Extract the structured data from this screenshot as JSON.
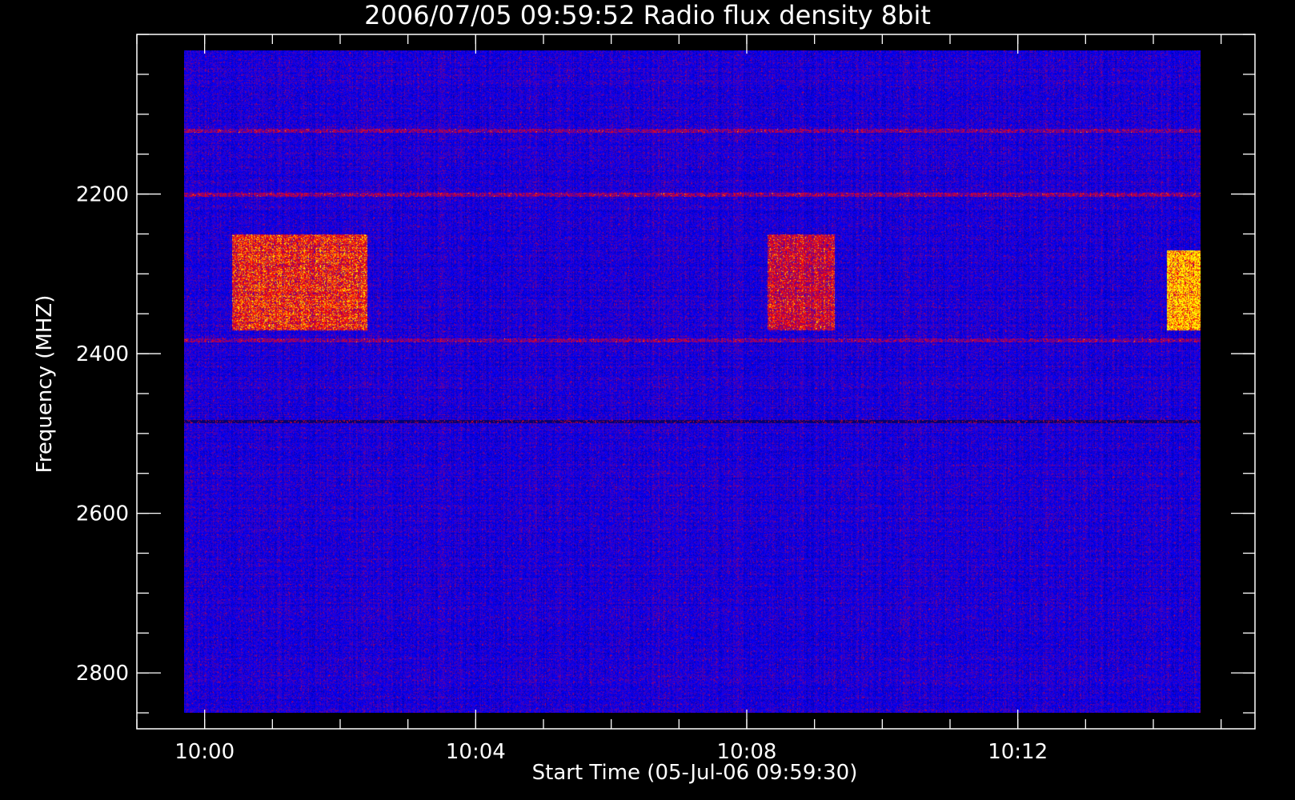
{
  "chart_data": {
    "type": "heatmap",
    "title": "2006/07/05 09:59:52 Radio flux density 8bit",
    "xlabel": "Start Time (05-Jul-06 09:59:30)",
    "ylabel": "Frequency (MHZ)",
    "x_ticks": [
      {
        "label": "10:00",
        "minutes": 0
      },
      {
        "label": "10:04",
        "minutes": 4
      },
      {
        "label": "10:08",
        "minutes": 8
      },
      {
        "label": "10:12",
        "minutes": 12
      }
    ],
    "x_minor_step_minutes": 1,
    "xlim_minutes_from_10_00": [
      -1.0,
      15.5
    ],
    "data_x_range_minutes": [
      -0.3,
      14.7
    ],
    "y_ticks": [
      2200,
      2400,
      2600,
      2800
    ],
    "y_minor_step_mhz": 50,
    "ylim_mhz": [
      2870,
      2000
    ],
    "data_y_range_mhz": [
      2020,
      2850
    ],
    "colormap": [
      "#000000",
      "#0000ff",
      "#ff0000",
      "#ffff00"
    ],
    "background_color": "#000000",
    "bright_lines_mhz": [
      2120,
      2200,
      2383
    ],
    "dark_lines_mhz": [
      2485
    ],
    "bursts": [
      {
        "t0": 0.4,
        "t1": 2.4,
        "f0": 2250,
        "f1": 2370,
        "level": 0.55
      },
      {
        "t0": 8.3,
        "t1": 9.3,
        "f0": 2250,
        "f1": 2370,
        "level": 0.45
      },
      {
        "t0": 14.2,
        "t1": 14.7,
        "f0": 2270,
        "f1": 2370,
        "level": 0.85
      }
    ]
  }
}
